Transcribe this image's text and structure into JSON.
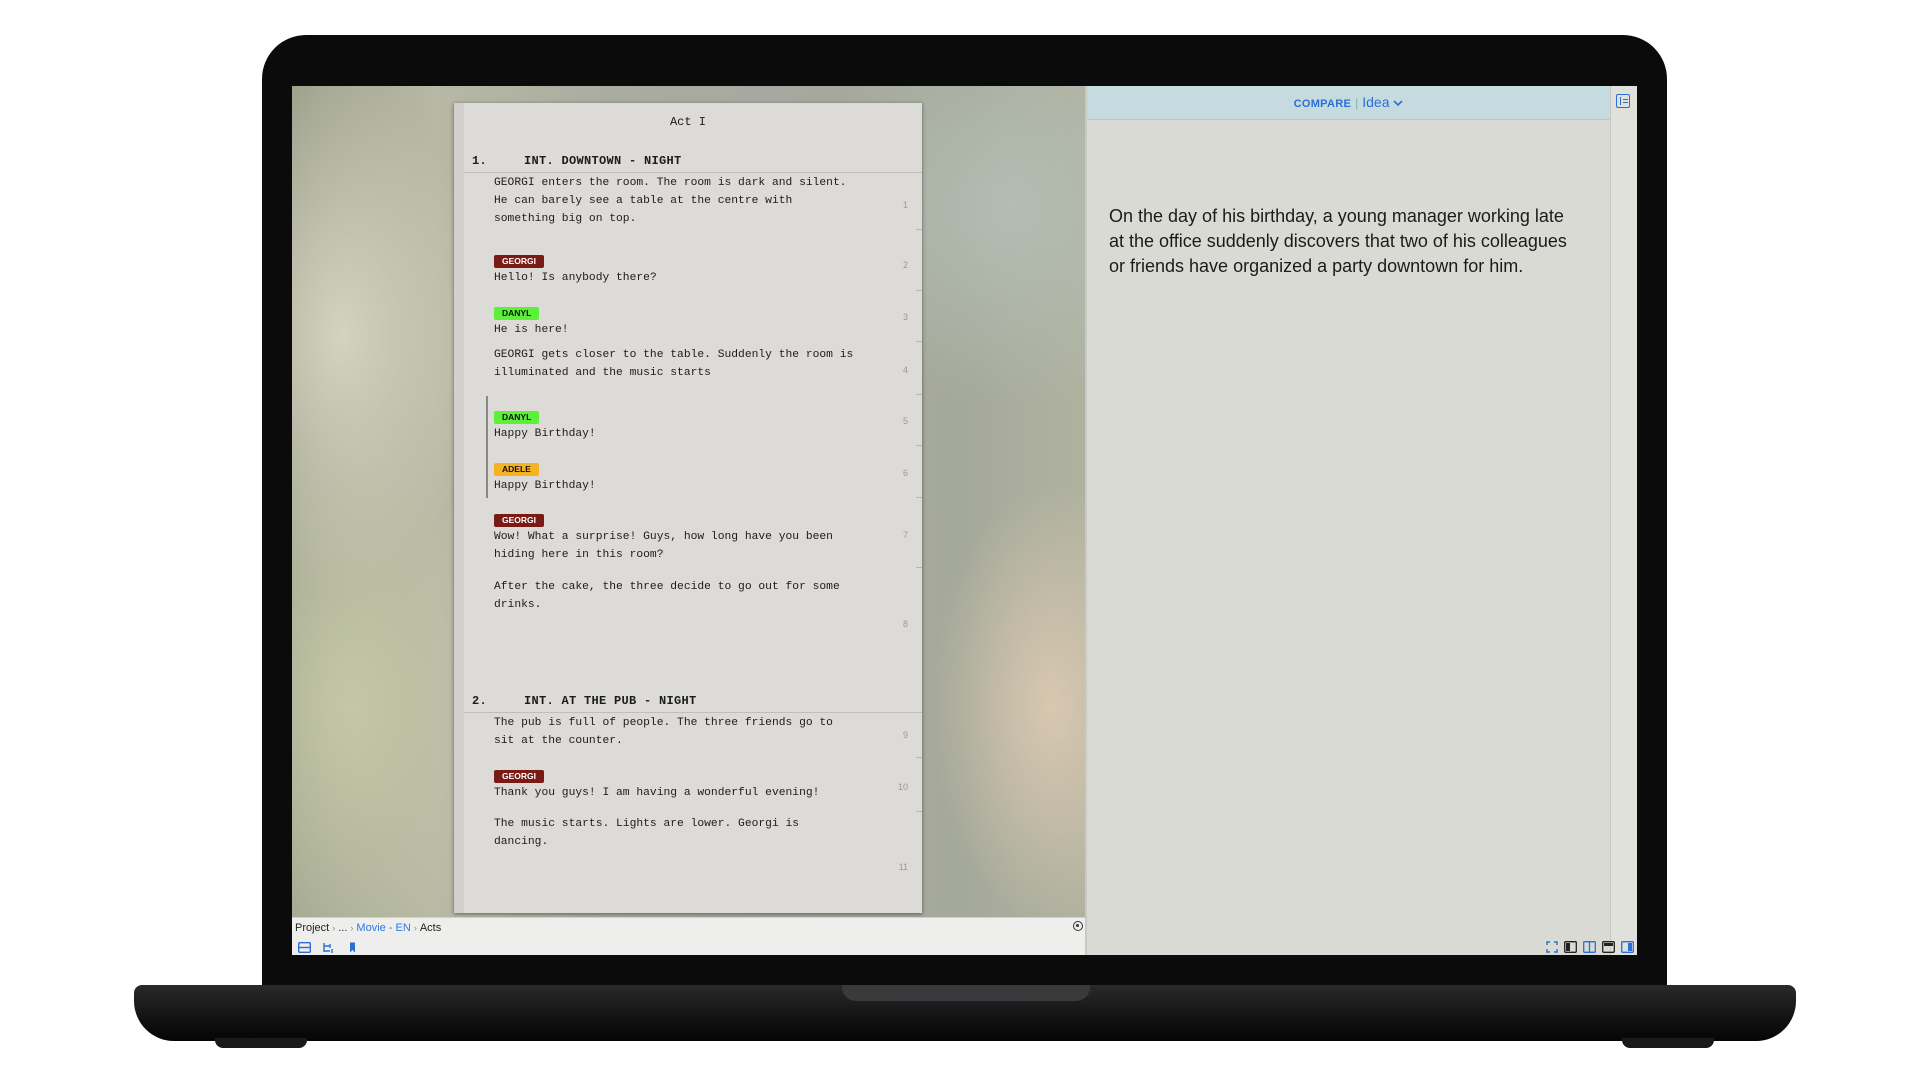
{
  "editor": {
    "act_title": "Act I",
    "scenes": [
      {
        "number": "1.",
        "heading": "INT. DOWNTOWN - NIGHT",
        "blocks": [
          {
            "type": "action",
            "lines": [
              "GEORGI enters the room. The room is dark and silent.",
              "He can barely see a table at the centre with",
              "something big on top."
            ],
            "line_number": "1"
          },
          {
            "type": "dialog",
            "character": "GEORGI",
            "text": "Hello! Is anybody there?",
            "line_number": "2"
          },
          {
            "type": "dialog",
            "character": "DANYL",
            "text": "He is here!",
            "line_number": "3"
          },
          {
            "type": "action",
            "lines": [
              "GEORGI gets closer to the table. Suddenly the room is",
              "illuminated and the music starts"
            ],
            "line_number": "4"
          },
          {
            "type": "dialog",
            "character": "DANYL",
            "text": "Happy Birthday!",
            "line_number": "5"
          },
          {
            "type": "dialog",
            "character": "ADELE",
            "text": "Happy Birthday!",
            "line_number": "6"
          },
          {
            "type": "dialog",
            "character": "GEORGI",
            "lines": [
              "Wow! What a surprise! Guys, how long have you been",
              "hiding here in this room?"
            ],
            "line_number": "7"
          },
          {
            "type": "action",
            "lines": [
              "After the cake, the three decide to go out for some",
              "drinks."
            ],
            "line_number": "8"
          }
        ]
      },
      {
        "number": "2.",
        "heading": "INT. AT THE PUB - NIGHT",
        "blocks": [
          {
            "type": "action",
            "lines": [
              "The pub is full of people. The three friends go to",
              "sit at the counter."
            ],
            "line_number": "9"
          },
          {
            "type": "dialog",
            "character": "GEORGI",
            "text": "Thank you guys! I am having a wonderful evening!",
            "line_number": "10"
          },
          {
            "type": "action",
            "lines": [
              "The music starts. Lights are lower. Georgi is",
              "dancing."
            ],
            "line_number": "11"
          }
        ]
      }
    ]
  },
  "characters": {
    "GEORGI": {
      "label": "GEORGI",
      "color": "#7a1a14",
      "text_color": "#ffffff"
    },
    "DANYL": {
      "label": "DANYL",
      "color": "#5cf03a",
      "text_color": "#111111"
    },
    "ADELE": {
      "label": "ADELE",
      "color": "#f5b324",
      "text_color": "#111111"
    }
  },
  "breadcrumb": {
    "items": [
      "Project",
      "...",
      "Movie - EN",
      "Acts"
    ]
  },
  "compare": {
    "label": "COMPARE",
    "selected": "Idea"
  },
  "idea_panel": {
    "text": "On the day of his birthday, a young manager working late at the office suddenly discovers that two of his colleagues or friends have organized a party downtown for him."
  },
  "icons": {
    "left_toolbar": [
      "layout-icon",
      "structure-icon",
      "bookmark-icon"
    ],
    "right_toolbar": [
      "expand-icon",
      "sidebar-left-icon",
      "split-view-icon",
      "top-panel-icon",
      "sidebar-right-icon"
    ],
    "status": "settings-icon",
    "panel_toggle": "panel-icon"
  },
  "colors": {
    "accent": "#2b6fd6",
    "compare_bar": "#c5dbe0"
  }
}
